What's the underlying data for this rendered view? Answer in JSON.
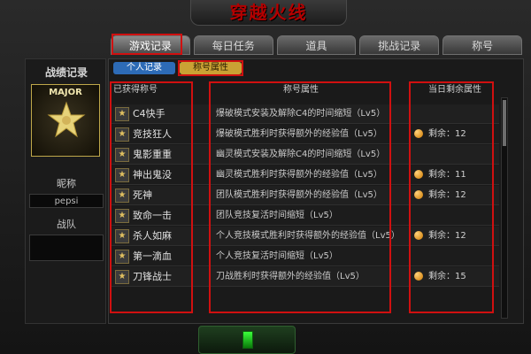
{
  "header": {
    "title": "穿越火线"
  },
  "tabs": [
    {
      "label": "游戏记录"
    },
    {
      "label": "每日任务"
    },
    {
      "label": "道具"
    },
    {
      "label": "挑战记录"
    },
    {
      "label": "称号"
    }
  ],
  "sidebar": {
    "title": "战绩记录",
    "rank": "MAJOR",
    "nickname_label": "昵称",
    "nickname": "pepsi",
    "team_label": "战队",
    "team": ""
  },
  "subtabs": [
    {
      "label": "个人记录"
    },
    {
      "label": "称号属性"
    }
  ],
  "table": {
    "columns": [
      "已获得称号",
      "称号属性",
      "当日剩余属性"
    ],
    "rows": [
      {
        "name": "C4快手",
        "attr": "爆破模式安装及解除C4的时间缩短（Lv5）",
        "remain": ""
      },
      {
        "name": "竞技狂人",
        "attr": "爆破模式胜利时获得额外的经验值（Lv5）",
        "remain": "剩余：12"
      },
      {
        "name": "鬼影重重",
        "attr": "幽灵模式安装及解除C4的时间缩短（Lv5）",
        "remain": ""
      },
      {
        "name": "神出鬼没",
        "attr": "幽灵模式胜利时获得额外的经验值（Lv5）",
        "remain": "剩余：11"
      },
      {
        "name": "死神",
        "attr": "团队模式胜利时获得额外的经验值（Lv5）",
        "remain": "剩余：12"
      },
      {
        "name": "致命一击",
        "attr": "团队竞技复活时间缩短（Lv5）",
        "remain": ""
      },
      {
        "name": "杀人如麻",
        "attr": "个人竞技模式胜利时获得额外的经验值（Lv5）",
        "remain": "剩余：12"
      },
      {
        "name": "第一滴血",
        "attr": "个人竞技复活时间缩短（Lv5）",
        "remain": ""
      },
      {
        "name": "刀锋战士",
        "attr": "刀战胜利时获得额外的经验值（Lv5）",
        "remain": "剩余：15"
      }
    ]
  },
  "colors": {
    "highlight": "#d01010",
    "subtab_blue": "#2d6bb6",
    "subtab_gold": "#caa234"
  }
}
